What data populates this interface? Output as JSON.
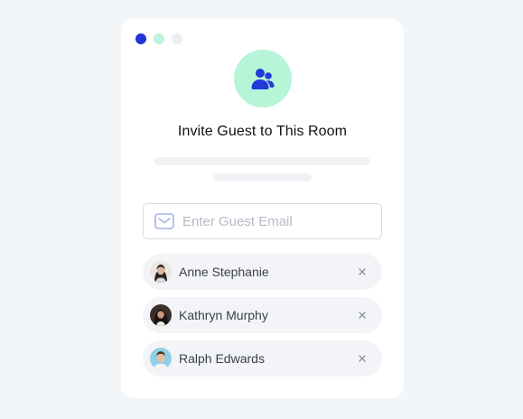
{
  "window": {
    "dots": [
      {
        "color": "#2534d6"
      },
      {
        "color": "#bff3db"
      },
      {
        "color": "#eceef4"
      }
    ]
  },
  "hero": {
    "icon": "users-icon",
    "bg_color": "#b7f5d9",
    "icon_color": "#2339d8"
  },
  "dialog": {
    "title": "Invite Guest to This Room"
  },
  "email_field": {
    "icon": "mail-icon",
    "value": "",
    "placeholder": "Enter Guest Email"
  },
  "guests": [
    {
      "name": "Anne Stephanie",
      "avatar": "person-avatar-anne",
      "remove_icon": "close-icon"
    },
    {
      "name": "Kathryn Murphy",
      "avatar": "person-avatar-kathryn",
      "remove_icon": "close-icon"
    },
    {
      "name": "Ralph Edwards",
      "avatar": "person-avatar-ralph",
      "remove_icon": "close-icon"
    }
  ]
}
